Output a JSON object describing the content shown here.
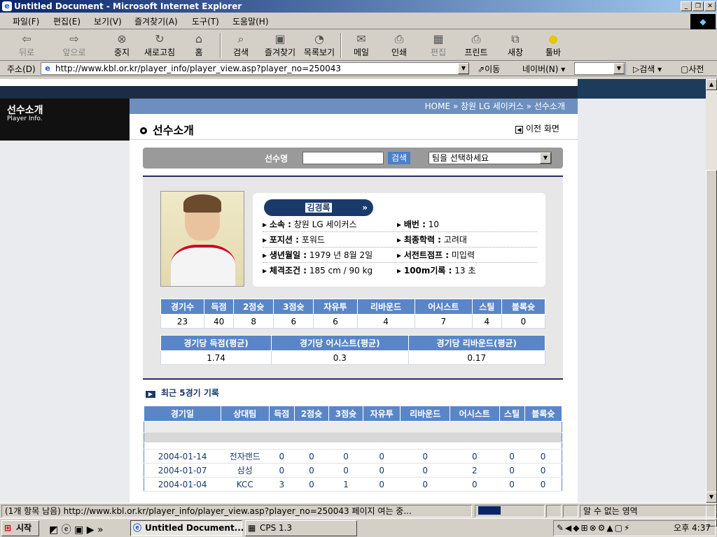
{
  "window": {
    "title": "Untitled Document - Microsoft Internet Explorer"
  },
  "menu": [
    "파일(F)",
    "편집(E)",
    "보기(V)",
    "즐겨찾기(A)",
    "도구(T)",
    "도움말(H)"
  ],
  "toolbar": {
    "back": "뒤로",
    "forward": "앞으로",
    "stop": "중지",
    "refresh": "새로고침",
    "home": "홈",
    "search": "검색",
    "favorites": "즐겨찾기",
    "history": "목록보기",
    "mail": "메일",
    "print": "인쇄",
    "edit": "편집",
    "printer": "프린트",
    "newwin": "새창",
    "toolbar": "툴바"
  },
  "address": {
    "label": "주소(D)",
    "url": "http://www.kbl.or.kr/player_info/player_view.asp?player_no=250043",
    "go": "이동",
    "naver": "네이버(N)",
    "search": "검색",
    "dict": "사전"
  },
  "page": {
    "side_title": "선수소개",
    "side_sub": "Player Info.",
    "breadcrumb": "HOME » 창원 LG 세이커스 » 선수소개",
    "heading": "선수소개",
    "back_link": "이전 화면",
    "search": {
      "label": "선수명",
      "button": "검색",
      "team_select": "팀을 선택하세요"
    },
    "player": {
      "name": "김경록",
      "fields": [
        {
          "k": "소속 :",
          "v": "창원 LG 세이커스"
        },
        {
          "k": "배번 :",
          "v": "10"
        },
        {
          "k": "포지션 :",
          "v": "포워드"
        },
        {
          "k": "최종학력 :",
          "v": "고려대"
        },
        {
          "k": "생년월일 :",
          "v": "1979 년 8월 2일"
        },
        {
          "k": "서전트점프 :",
          "v": "미입력"
        },
        {
          "k": "체격조건 :",
          "v": "185 cm / 90 kg"
        },
        {
          "k": "100m기록 :",
          "v": "13 초"
        }
      ]
    },
    "totals": {
      "headers": [
        "경기수",
        "득점",
        "2점슛",
        "3점슛",
        "자유투",
        "리바운드",
        "어시스트",
        "스틸",
        "블록슛"
      ],
      "values": [
        "23",
        "40",
        "8",
        "6",
        "6",
        "4",
        "7",
        "4",
        "0"
      ]
    },
    "averages": {
      "headers": [
        "경기당 득점(평균)",
        "경기당 어시스트(평균)",
        "경기당 리바운드(평균)"
      ],
      "values": [
        "1.74",
        "0.3",
        "0.17"
      ]
    },
    "recent": {
      "title": "최근 5경기 기록",
      "headers": [
        "경기일",
        "상대팀",
        "득점",
        "2점슛",
        "3점슛",
        "자유투",
        "리바운드",
        "어시스트",
        "스틸",
        "블록슛"
      ],
      "rows": [
        [
          "2004-01-14",
          "전자랜드",
          "0",
          "0",
          "0",
          "0",
          "0",
          "0",
          "0",
          "0"
        ],
        [
          "2004-01-07",
          "삼성",
          "0",
          "0",
          "0",
          "0",
          "0",
          "2",
          "0",
          "0"
        ],
        [
          "2004-01-04",
          "KCC",
          "3",
          "0",
          "1",
          "0",
          "0",
          "0",
          "0",
          "0"
        ]
      ]
    }
  },
  "status": {
    "text": "(1개 항목 남음) http://www.kbl.or.kr/player_info/player_view.asp?player_no=250043 페이지 여는 중...",
    "zone": "알 수 없는 영역"
  },
  "taskbar": {
    "start": "시작",
    "task1": "Untitled Document...",
    "task2": "CPS 1.3",
    "clock": "오후 4:37"
  }
}
